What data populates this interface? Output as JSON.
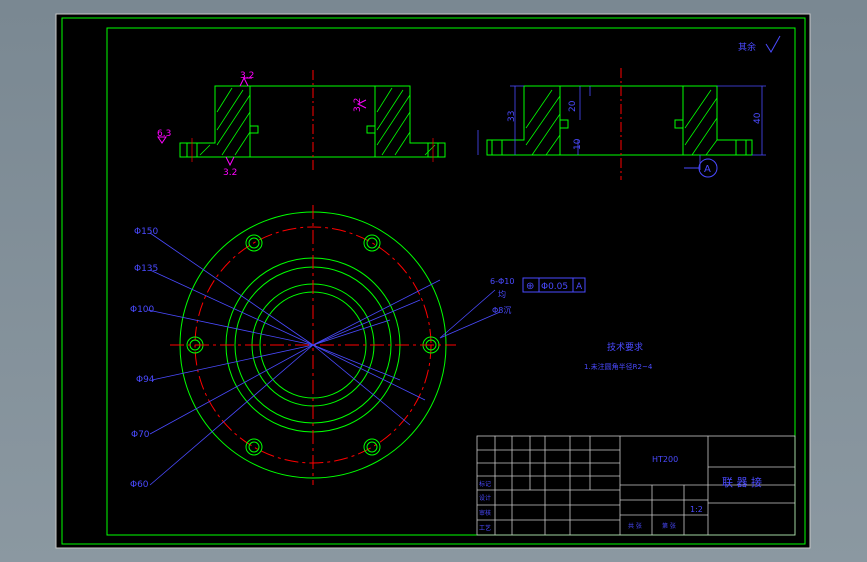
{
  "colors": {
    "background": "#000000",
    "frame": "#00ff00",
    "annotation": "#4a4aff",
    "centerline": "#ff0000",
    "part": "#00ff00",
    "symbol": "#ff00ff",
    "bolt_circle": "#ff0000"
  },
  "top_note": "其余",
  "section_left": {
    "roughness_top": "3.2",
    "roughness_side": "6.3",
    "roughness_right": "3.2",
    "roughness_bottom": "3.2"
  },
  "section_right": {
    "dim_height_1": "33",
    "dim_height_2": "20",
    "dim_height_3": "10",
    "dim_total": "40",
    "datum": "A"
  },
  "plan_view": {
    "diameters": [
      "Φ150",
      "Φ135",
      "Φ100",
      "Φ94",
      "Φ70",
      "Φ60"
    ],
    "hole_note": "6-Φ10",
    "hole_note_sub": "均",
    "hole_note_sub2": "Φ8沉",
    "tolerance_symbol": "⊕",
    "tolerance_value": "Φ0.05",
    "tolerance_datum": "A"
  },
  "tech_requirements": {
    "title": "技术要求",
    "item_1": "1.未注圆角半径R2~4"
  },
  "title_block": {
    "material": "HT200",
    "part_name": "联 器 接",
    "scale": "1:2",
    "row_labels": [
      "标记",
      "设计",
      "审核",
      "工艺"
    ],
    "sheet_info": [
      "共 张",
      "第 张"
    ]
  }
}
